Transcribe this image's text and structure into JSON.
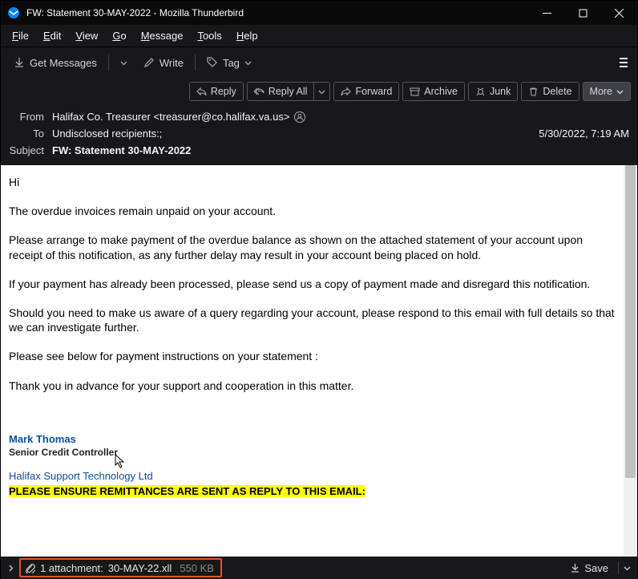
{
  "titlebar": {
    "title": "FW: Statement 30-MAY-2022 - Mozilla Thunderbird"
  },
  "menubar": {
    "file": "File",
    "edit": "Edit",
    "view": "View",
    "go": "Go",
    "message": "Message",
    "tools": "Tools",
    "help": "Help"
  },
  "toolbar": {
    "get_messages": "Get Messages",
    "write": "Write",
    "tag": "Tag"
  },
  "actions": {
    "reply": "Reply",
    "reply_all": "Reply All",
    "forward": "Forward",
    "archive": "Archive",
    "junk": "Junk",
    "delete": "Delete",
    "more": "More"
  },
  "headers": {
    "from_label": "From",
    "from_value": "Halifax Co. Treasurer <treasurer@co.halifax.va.us>",
    "to_label": "To",
    "to_value": "Undisclosed recipients:;",
    "date": "5/30/2022, 7:19 AM",
    "subject_label": "Subject",
    "subject_value": "FW: Statement 30-MAY-2022"
  },
  "body": {
    "greeting": "Hi",
    "p1": "The overdue invoices remain unpaid on your account.",
    "p2": "Please arrange to make payment of the overdue balance as shown on the attached statement of your account upon receipt of this notification, as any further delay may result in your account being placed on hold.",
    "p3": "If your payment has already been processed, please send us a copy of payment made and disregard this notification.",
    "p4": "Should you need to make us aware of a query regarding your account, please respond to this email with full details so that we can investigate further.",
    "p5": "Please see below for payment instructions on your statement :",
    "p6": "Thank you in advance for your support and cooperation in this matter.",
    "sig_name": "Mark Thomas",
    "sig_title": "Senior Credit Controller",
    "sig_company": "Halifax Support Technology  Ltd",
    "sig_notice": "PLEASE ENSURE REMITTANCES ARE SENT AS REPLY TO THIS EMAIL:"
  },
  "attachment": {
    "count_label": "1 attachment:",
    "filename": "30-MAY-22.xll",
    "size": "550 KB",
    "save": "Save"
  }
}
